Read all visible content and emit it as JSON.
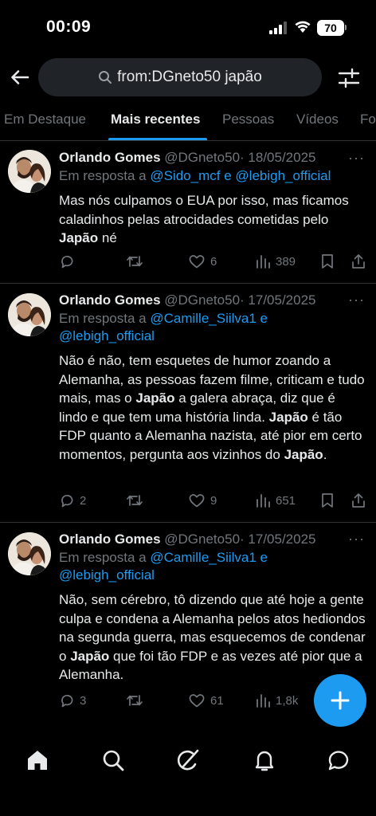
{
  "status_bar": {
    "time": "00:09",
    "battery": "70"
  },
  "search": {
    "query": "from:DGneto50 japão"
  },
  "tabs": [
    {
      "label": "Em Destaque",
      "active": false
    },
    {
      "label": "Mais recentes",
      "active": true
    },
    {
      "label": "Pessoas",
      "active": false
    },
    {
      "label": "Vídeos",
      "active": false
    },
    {
      "label": "Fo",
      "active": false
    }
  ],
  "tweets": [
    {
      "name": "Orlando Gomes",
      "handle": "@DGneto50",
      "date": "· 18/05/2025",
      "reply_prefix": "Em resposta a",
      "mention_1": "@Sido_mcf",
      "connector": "e",
      "mention_2": "@lebigh_official",
      "text_parts": [
        "Mas nós culpamos o EUA por isso, mas ficamos caladinhos pelas atrocidades cometidas pelo ",
        "Japão",
        " né"
      ],
      "replies": "",
      "retweets": "",
      "likes": "6",
      "views": "389"
    },
    {
      "name": "Orlando Gomes",
      "handle": "@DGneto50",
      "date": "· 17/05/2025",
      "reply_prefix": "Em resposta a",
      "mention_1": "@Camille_Siilva1",
      "connector": "e",
      "mention_2": "@lebigh_official",
      "text_parts": [
        "Não é não, tem esquetes de humor zoando a Alemanha, as pessoas fazem filme, criticam e tudo mais, mas o ",
        "Japão",
        " a galera abraça, diz que é lindo e que tem uma história linda. ",
        "Japão",
        " é tão FDP quanto a Alemanha nazista, até pior em certo momentos, pergunta aos vizinhos do ",
        "Japão",
        "."
      ],
      "replies": "2",
      "retweets": "",
      "likes": "9",
      "views": "651"
    },
    {
      "name": "Orlando Gomes",
      "handle": "@DGneto50",
      "date": "· 17/05/2025",
      "reply_prefix": "Em resposta a",
      "mention_1": "@Camille_Siilva1",
      "connector": "e",
      "mention_2": "@lebigh_official",
      "text_parts": [
        "Não, sem cérebro, tô dizendo que até hoje a gente culpa e condena a Alemanha pelos atos hediondos na segunda guerra, mas esquecemos de condenar o ",
        "Japão",
        " que foi tão FDP e as vezes até pior que a Alemanha."
      ],
      "replies": "3",
      "retweets": "",
      "likes": "61",
      "views": "1,8k"
    }
  ],
  "colors": {
    "accent": "#1d9bf0",
    "background": "#000000",
    "muted": "#71767b",
    "text": "#e7e9ea"
  },
  "icons": [
    "back-arrow-icon",
    "search-icon",
    "filter-sliders-icon",
    "reply-icon",
    "retweet-icon",
    "like-icon",
    "views-icon",
    "bookmark-icon",
    "share-icon",
    "compose-plus-icon",
    "home-icon",
    "explore-icon",
    "grok-icon",
    "notifications-icon",
    "messages-icon"
  ]
}
